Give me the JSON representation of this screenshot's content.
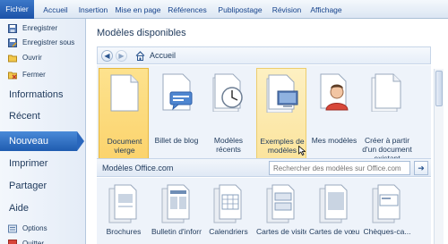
{
  "ribbon": {
    "file": "Fichier",
    "tabs": [
      "Accueil",
      "Insertion",
      "Mise en page",
      "Références",
      "Publipostage",
      "Révision",
      "Affichage"
    ]
  },
  "sidebar": {
    "small": [
      "Enregistrer",
      "Enregistrer sous",
      "Ouvrir",
      "Fermer"
    ],
    "large": [
      "Informations",
      "Récent",
      "Nouveau",
      "Imprimer",
      "Partager",
      "Aide"
    ],
    "bottom": [
      "Options",
      "Quitter"
    ]
  },
  "main": {
    "title": "Modèles disponibles",
    "breadcrumb": "Accueil",
    "tiles": [
      {
        "label": "Document vierge"
      },
      {
        "label": "Billet de blog"
      },
      {
        "label": "Modèles récents"
      },
      {
        "label": "Exemples de modèles"
      },
      {
        "label": "Mes modèles"
      },
      {
        "label": "Créer à partir d'un document existant"
      }
    ],
    "office_title": "Modèles Office.com",
    "search_placeholder": "Rechercher des modèles sur Office.com",
    "office_tiles": [
      {
        "label": "Brochures"
      },
      {
        "label": "Bulletin d'informati..."
      },
      {
        "label": "Calendriers"
      },
      {
        "label": "Cartes de visite"
      },
      {
        "label": "Cartes de vœux"
      },
      {
        "label": "Chèques-ca..."
      }
    ]
  },
  "colors": {
    "accent": "#2a67bd",
    "selected": "#fbd26a"
  }
}
